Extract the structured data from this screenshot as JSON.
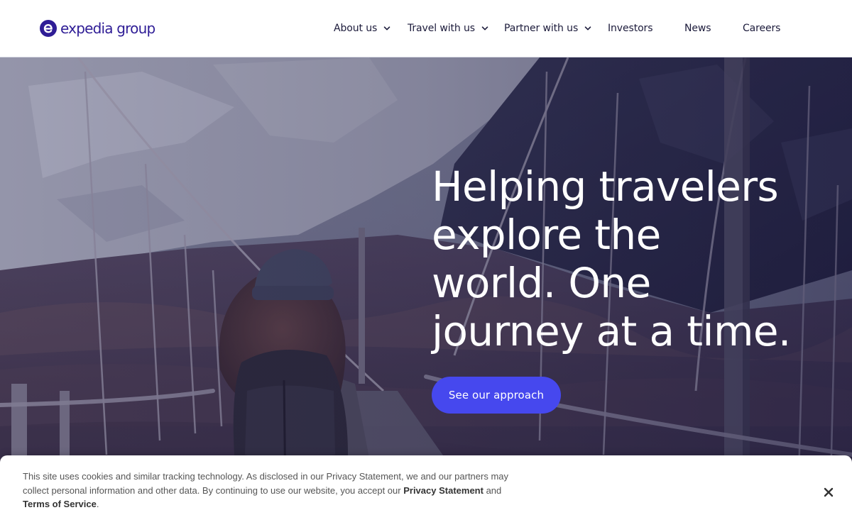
{
  "brand": {
    "name": "expedia group",
    "color": "#2f1d96"
  },
  "nav": {
    "items": [
      {
        "label": "About us",
        "has_dropdown": true
      },
      {
        "label": "Travel with us",
        "has_dropdown": true
      },
      {
        "label": "Partner with us",
        "has_dropdown": true
      },
      {
        "label": "Investors",
        "has_dropdown": false
      },
      {
        "label": "News",
        "has_dropdown": false
      },
      {
        "label": "Careers",
        "has_dropdown": false
      }
    ],
    "chevron_icon": "chevron-down-icon"
  },
  "hero": {
    "title_lines": [
      "Helping travelers",
      "explore the",
      "world. One",
      "journey at a time."
    ],
    "cta_label": "See our approach",
    "cta_color": "#4648ee",
    "background": "hiker with backpack on a suspension bridge, snowy mountains"
  },
  "cookie_banner": {
    "text_before": "This site uses cookies and similar tracking technology. As disclosed in our Privacy Statement, we and our partners may collect personal information and other data. By continuing to use our website, you accept our",
    "privacy_link": "Privacy Statement",
    "text_middle": "and",
    "terms_link": "Terms of Service",
    "text_after": ".",
    "close_icon": "close-icon"
  }
}
